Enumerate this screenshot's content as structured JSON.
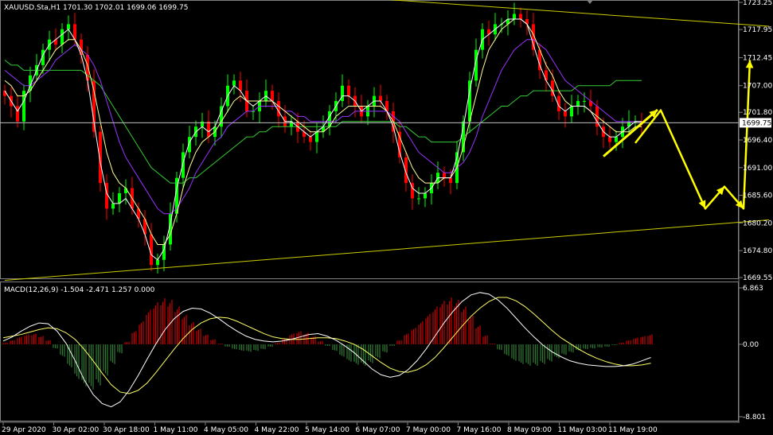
{
  "chart_data": [
    {
      "type": "candlestick",
      "title": "XAUUSD.Sta,H1  1701.30 1702.01 1699.06 1699.75",
      "symbol": "XAUUSD.Sta",
      "timeframe": "H1",
      "ohlc_last": {
        "open": 1701.3,
        "high": 1702.01,
        "low": 1699.06,
        "close": 1699.75
      },
      "current_price_label": "1699.75",
      "ylim": [
        1669.55,
        1723.25
      ],
      "y_ticks": [
        "1723.25",
        "1717.95",
        "1712.45",
        "1707.00",
        "1701.80",
        "1696.40",
        "1691.00",
        "1685.60",
        "1680.20",
        "1674.80",
        "1669.55"
      ],
      "x_ticks": [
        "29 Apr 2020",
        "30 Apr 02:00",
        "30 Apr 18:00",
        "1 May 11:00",
        "4 May 05:00",
        "4 May 22:00",
        "5 May 14:00",
        "6 May 07:00",
        "7 May 00:00",
        "7 May 16:00",
        "8 May 09:00",
        "11 May 03:00",
        "11 May 19:00"
      ],
      "colors": {
        "up": "#00ff00",
        "down": "#ff0000",
        "ma_fast": "#ffffff",
        "ma_mid": "#ffff99",
        "ma_slow": "#9933ff",
        "ma_long": "#33cc33",
        "trend": "#cccc00",
        "arrows": "#ffff00"
      },
      "closes": [
        1705,
        1703,
        1700,
        1706,
        1709,
        1711,
        1714,
        1716,
        1715,
        1718,
        1719,
        1716,
        1713,
        1708,
        1698,
        1688,
        1683,
        1684,
        1686,
        1687,
        1683,
        1681,
        1678,
        1672,
        1673,
        1676,
        1682,
        1689,
        1694,
        1697,
        1699,
        1700,
        1697,
        1699,
        1703,
        1707,
        1708,
        1706,
        1702,
        1702,
        1704,
        1706,
        1704,
        1701,
        1699,
        1700,
        1698,
        1697,
        1696,
        1698,
        1699,
        1702,
        1704,
        1707,
        1705,
        1703,
        1701,
        1703,
        1705,
        1704,
        1702,
        1698,
        1693,
        1688,
        1685,
        1685,
        1686,
        1688,
        1690,
        1689,
        1688,
        1694,
        1700,
        1708,
        1714,
        1718,
        1717,
        1719,
        1719,
        1720,
        1721,
        1720,
        1719,
        1714,
        1710,
        1708,
        1705,
        1702,
        1701,
        1703,
        1704,
        1704,
        1703,
        1699,
        1697,
        1696,
        1697,
        1699,
        1700,
        1700,
        1699.75
      ],
      "ma_fast": [
        1706,
        1704,
        1702,
        1704,
        1707,
        1710,
        1713,
        1715,
        1716,
        1717,
        1718,
        1716,
        1713,
        1708,
        1700,
        1692,
        1686,
        1684,
        1684,
        1685,
        1683,
        1681,
        1678,
        1674,
        1673,
        1675,
        1680,
        1687,
        1692,
        1696,
        1698,
        1699,
        1698,
        1699,
        1702,
        1705,
        1707,
        1706,
        1704,
        1703,
        1704,
        1705,
        1704,
        1702,
        1700,
        1700,
        1699,
        1698,
        1697,
        1698,
        1699,
        1701,
        1703,
        1705,
        1705,
        1704,
        1702,
        1703,
        1704,
        1704,
        1702,
        1699,
        1694,
        1690,
        1687,
        1686,
        1686,
        1687,
        1689,
        1689,
        1689,
        1693,
        1699,
        1706,
        1712,
        1716,
        1717,
        1718,
        1719,
        1720,
        1720,
        1720,
        1719,
        1715,
        1711,
        1708,
        1706,
        1703,
        1702,
        1703,
        1703,
        1703,
        1702,
        1700,
        1698,
        1697,
        1697,
        1698,
        1699,
        1700,
        1700
      ],
      "ma_mid": [
        1708,
        1707,
        1705,
        1705,
        1706,
        1708,
        1710,
        1712,
        1714,
        1715,
        1716,
        1716,
        1714,
        1711,
        1706,
        1700,
        1694,
        1690,
        1688,
        1687,
        1685,
        1683,
        1681,
        1678,
        1676,
        1676,
        1678,
        1682,
        1687,
        1691,
        1694,
        1696,
        1697,
        1698,
        1700,
        1702,
        1704,
        1705,
        1704,
        1704,
        1704,
        1704,
        1704,
        1703,
        1702,
        1701,
        1700,
        1699,
        1698,
        1698,
        1698,
        1699,
        1701,
        1702,
        1703,
        1703,
        1703,
        1703,
        1703,
        1703,
        1702,
        1700,
        1697,
        1694,
        1691,
        1689,
        1688,
        1688,
        1688,
        1689,
        1689,
        1691,
        1695,
        1700,
        1705,
        1710,
        1714,
        1716,
        1718,
        1719,
        1720,
        1720,
        1719,
        1717,
        1714,
        1711,
        1709,
        1706,
        1704,
        1703,
        1703,
        1703,
        1702,
        1701,
        1700,
        1699,
        1698,
        1698,
        1698,
        1699,
        1699
      ],
      "ma_slow": [
        1710,
        1709,
        1708,
        1707,
        1707,
        1708,
        1709,
        1710,
        1712,
        1713,
        1714,
        1715,
        1714,
        1713,
        1711,
        1708,
        1704,
        1700,
        1696,
        1693,
        1691,
        1689,
        1687,
        1685,
        1683,
        1682,
        1682,
        1683,
        1685,
        1687,
        1690,
        1692,
        1694,
        1696,
        1697,
        1699,
        1700,
        1701,
        1702,
        1702,
        1703,
        1703,
        1703,
        1703,
        1702,
        1702,
        1701,
        1701,
        1700,
        1700,
        1700,
        1700,
        1700,
        1701,
        1701,
        1702,
        1702,
        1702,
        1702,
        1702,
        1702,
        1701,
        1700,
        1698,
        1696,
        1694,
        1693,
        1692,
        1691,
        1690,
        1690,
        1691,
        1692,
        1694,
        1697,
        1701,
        1704,
        1707,
        1710,
        1712,
        1714,
        1715,
        1716,
        1716,
        1715,
        1714,
        1712,
        1710,
        1708,
        1707,
        1706,
        1705,
        1704,
        1703,
        1702,
        1701,
        1700,
        1700,
        1700,
        1700,
        1700
      ],
      "ma_long": [
        1712,
        1711,
        1711,
        1710,
        1710,
        1710,
        1710,
        1710,
        1710,
        1710,
        1710,
        1710,
        1710,
        1709,
        1708,
        1707,
        1705,
        1703,
        1701,
        1699,
        1697,
        1695,
        1693,
        1691,
        1690,
        1689,
        1688,
        1688,
        1688,
        1689,
        1689,
        1690,
        1691,
        1692,
        1693,
        1694,
        1695,
        1696,
        1697,
        1697,
        1698,
        1698,
        1699,
        1699,
        1699,
        1699,
        1699,
        1699,
        1699,
        1699,
        1699,
        1699,
        1699,
        1700,
        1700,
        1700,
        1700,
        1700,
        1700,
        1700,
        1700,
        1700,
        1699,
        1699,
        1698,
        1697,
        1697,
        1696,
        1696,
        1696,
        1696,
        1696,
        1697,
        1698,
        1699,
        1700,
        1701,
        1702,
        1703,
        1703,
        1704,
        1705,
        1705,
        1706,
        1706,
        1706,
        1706,
        1706,
        1706,
        1706,
        1707,
        1707,
        1707,
        1707,
        1707,
        1707,
        1708,
        1708,
        1708,
        1708,
        1708
      ],
      "trend_lines": [
        {
          "name": "upper",
          "from": {
            "bar": 44,
            "price": 1725.2
          },
          "to": {
            "bar": 120,
            "price": 1718.6
          }
        },
        {
          "name": "lower",
          "from": {
            "bar": 0,
            "price": 1669.0
          },
          "to": {
            "bar": 120,
            "price": 1680.8
          }
        }
      ],
      "forecast_path": [
        {
          "bar": 99,
          "price": 1695.8
        },
        {
          "bar": 103,
          "price": 1702.2
        },
        {
          "bar": 110,
          "price": 1683.0
        },
        {
          "bar": 113,
          "price": 1687.3
        },
        {
          "bar": 116,
          "price": 1683.0
        },
        {
          "bar": 117,
          "price": 1712.0
        }
      ]
    },
    {
      "type": "histogram",
      "title": "MACD(12,26,9) -1.504 -2.471 1.257 0.000",
      "ylim": [
        -8.801,
        6.863
      ],
      "y_ticks": [
        "6.863",
        "0.00",
        "-8.801"
      ],
      "histogram": [
        0.2,
        0.5,
        0.9,
        1.2,
        1.3,
        1.0,
        0.5,
        -0.5,
        -1.5,
        -2.8,
        -4.2,
        -5.1,
        -5.5,
        -5.0,
        -3.8,
        -2.4,
        -1.1,
        0.3,
        1.6,
        2.8,
        4.2,
        5.1,
        5.6,
        5.4,
        4.6,
        3.6,
        2.7,
        1.9,
        1.2,
        0.6,
        0.1,
        -0.3,
        -0.6,
        -0.8,
        -0.9,
        -0.8,
        -0.6,
        -0.3,
        0.2,
        0.7,
        1.3,
        1.6,
        1.4,
        1.0,
        0.4,
        -0.2,
        -0.8,
        -1.5,
        -2.1,
        -2.5,
        -2.6,
        -2.3,
        -1.7,
        -1.0,
        -0.2,
        0.5,
        1.3,
        2.0,
        2.8,
        3.7,
        4.6,
        5.3,
        5.7,
        5.4,
        4.6,
        3.5,
        2.3,
        1.1,
        0.1,
        -0.7,
        -1.4,
        -2.0,
        -2.4,
        -2.6,
        -2.6,
        -2.4,
        -2.1,
        -1.7,
        -1.3,
        -1.0,
        -0.8,
        -0.6,
        -0.5,
        -0.4,
        -0.3,
        -0.1,
        0.2,
        0.5,
        0.8,
        1.0,
        1.2
      ],
      "macd": [
        0.4,
        0.9,
        1.6,
        2.2,
        2.6,
        2.5,
        1.6,
        0.1,
        -2.0,
        -4.3,
        -6.1,
        -7.2,
        -7.6,
        -7.0,
        -5.6,
        -3.8,
        -1.8,
        0.1,
        1.8,
        3.1,
        4.0,
        4.4,
        4.3,
        3.8,
        3.1,
        2.3,
        1.6,
        1.0,
        0.6,
        0.4,
        0.3,
        0.4,
        0.6,
        0.9,
        1.2,
        1.3,
        1.0,
        0.5,
        -0.2,
        -1.0,
        -2.0,
        -3.0,
        -3.7,
        -4.0,
        -3.8,
        -3.1,
        -2.0,
        -0.6,
        1.0,
        2.6,
        4.0,
        5.2,
        6.0,
        6.3,
        6.1,
        5.4,
        4.4,
        3.2,
        2.0,
        0.9,
        -0.1,
        -0.9,
        -1.5,
        -2.0,
        -2.3,
        -2.5,
        -2.6,
        -2.7,
        -2.7,
        -2.6,
        -2.4,
        -2.0,
        -1.6
      ],
      "signal": [
        0.8,
        1.0,
        1.2,
        1.5,
        1.8,
        2.0,
        1.9,
        1.4,
        0.6,
        -0.6,
        -2.0,
        -3.5,
        -4.9,
        -5.8,
        -6.0,
        -5.6,
        -4.7,
        -3.4,
        -2.0,
        -0.6,
        0.7,
        1.8,
        2.6,
        3.1,
        3.3,
        3.2,
        2.8,
        2.3,
        1.8,
        1.3,
        0.9,
        0.7,
        0.6,
        0.6,
        0.7,
        0.8,
        0.8,
        0.7,
        0.4,
        0.0,
        -0.6,
        -1.4,
        -2.2,
        -2.9,
        -3.3,
        -3.4,
        -3.1,
        -2.5,
        -1.6,
        -0.4,
        0.9,
        2.2,
        3.4,
        4.4,
        5.2,
        5.7,
        5.7,
        5.3,
        4.6,
        3.7,
        2.7,
        1.7,
        0.8,
        0.1,
        -0.6,
        -1.2,
        -1.7,
        -2.1,
        -2.4,
        -2.6,
        -2.6,
        -2.5,
        -2.3
      ]
    }
  ]
}
